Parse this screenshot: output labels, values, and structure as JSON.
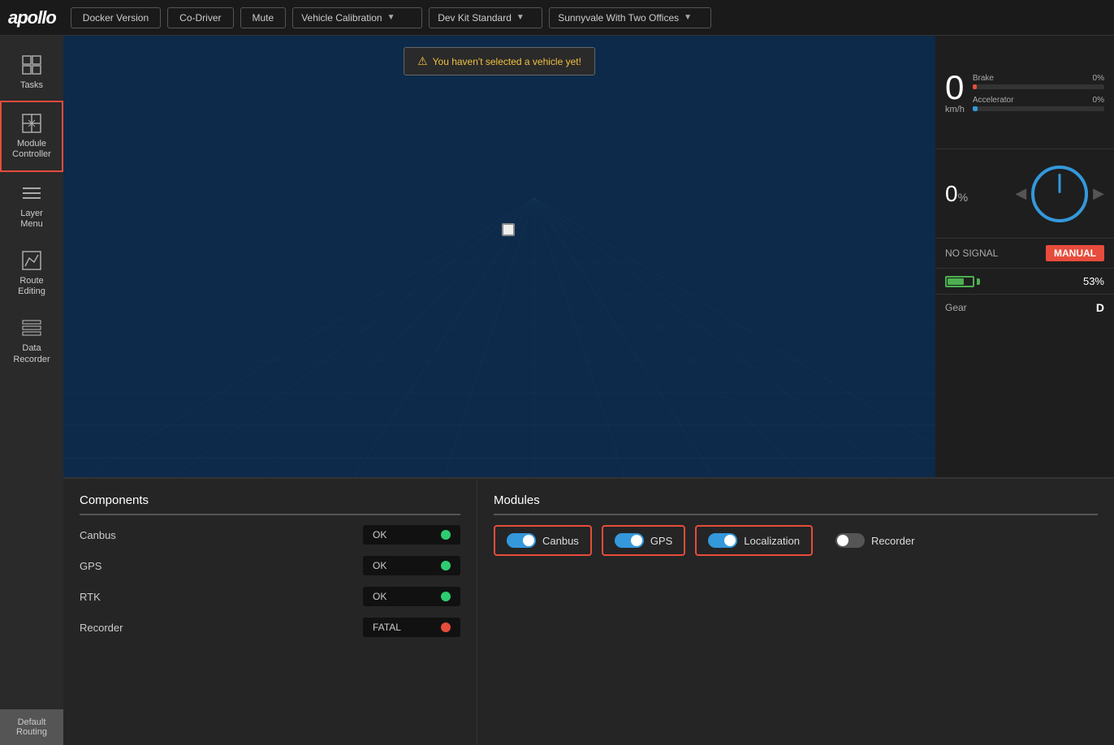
{
  "logo": "apollo",
  "nav": {
    "docker_version": "Docker Version",
    "co_driver": "Co-Driver",
    "mute": "Mute",
    "vehicle_calibration": "Vehicle Calibration",
    "dev_kit": "Dev Kit Standard",
    "location": "Sunnyvale With Two Offices"
  },
  "alert": {
    "icon": "⚠",
    "message": "You haven't selected a vehicle yet!"
  },
  "sidebar": {
    "items": [
      {
        "id": "tasks",
        "label": "Tasks",
        "icon": "tasks"
      },
      {
        "id": "module-controller",
        "label": "Module\nController",
        "icon": "module"
      },
      {
        "id": "layer-menu",
        "label": "Layer\nMenu",
        "icon": "layer"
      },
      {
        "id": "route-editing",
        "label": "Route\nEditing",
        "icon": "route"
      },
      {
        "id": "data-recorder",
        "label": "Data\nRecorder",
        "icon": "data"
      }
    ],
    "default_routing": "Default\nRouting"
  },
  "right_panel": {
    "speed": {
      "value": "0",
      "unit": "km/h"
    },
    "brake": {
      "label": "Brake",
      "percent": "0%",
      "fill": 3
    },
    "accelerator": {
      "label": "Accelerator",
      "percent": "0%",
      "fill": 4
    },
    "steering": {
      "value": "0",
      "unit": "%"
    },
    "signal": "NO SIGNAL",
    "mode": "MANUAL",
    "battery": "53%",
    "gear": {
      "label": "Gear",
      "value": "D"
    }
  },
  "components": {
    "title": "Components",
    "items": [
      {
        "name": "Canbus",
        "status": "OK",
        "indicator": "green"
      },
      {
        "name": "GPS",
        "status": "OK",
        "indicator": "green"
      },
      {
        "name": "RTK",
        "status": "OK",
        "indicator": "green"
      },
      {
        "name": "Recorder",
        "status": "FATAL",
        "indicator": "red"
      }
    ]
  },
  "modules": {
    "title": "Modules",
    "items": [
      {
        "id": "canbus",
        "label": "Canbus",
        "on": true,
        "bordered": true
      },
      {
        "id": "gps",
        "label": "GPS",
        "on": true,
        "bordered": true
      },
      {
        "id": "localization",
        "label": "Localization",
        "on": true,
        "bordered": true
      },
      {
        "id": "recorder",
        "label": "Recorder",
        "on": false,
        "bordered": false
      }
    ]
  }
}
